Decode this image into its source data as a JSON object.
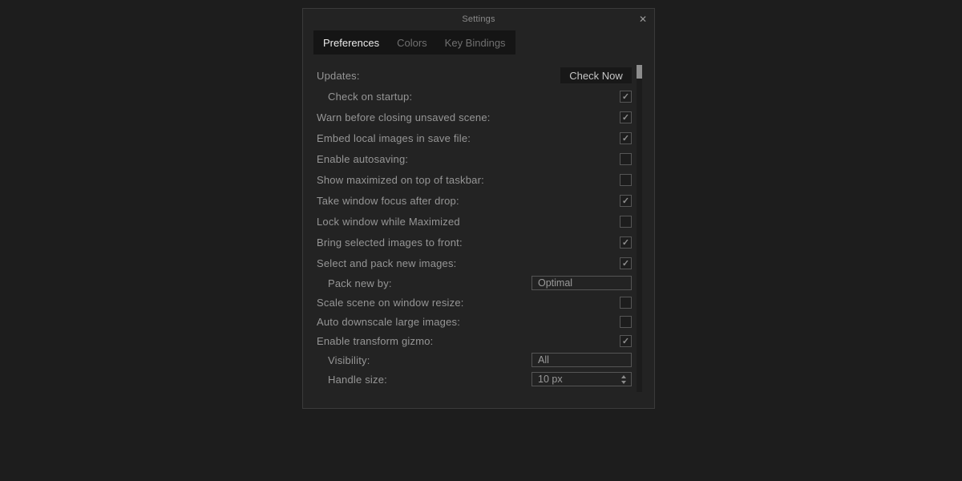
{
  "window": {
    "title": "Settings"
  },
  "icons": {
    "close": "✕",
    "check": "✓"
  },
  "colors": {
    "page_bg": "#1d1d1d",
    "dialog_bg": "#232323",
    "dialog_border": "#3a3a3a",
    "tabstrip_bg": "#151515",
    "active_tab_text": "#ebebeb",
    "inactive_tab_text": "#707070",
    "label_text": "#969696",
    "control_border": "#555555",
    "scroll_thumb": "#8d8d8d"
  },
  "tabs": [
    {
      "label": "Preferences",
      "active": true
    },
    {
      "label": "Colors",
      "active": false
    },
    {
      "label": "Key Bindings",
      "active": false
    }
  ],
  "preferences": {
    "rows": [
      {
        "name": "updates",
        "label": "Updates:",
        "indent": false,
        "control": "button",
        "value": "Check Now"
      },
      {
        "name": "check-on-startup",
        "label": "Check on startup:",
        "indent": true,
        "control": "checkbox",
        "checked": true
      },
      {
        "name": "warn-before-closing-unsaved-scene",
        "label": "Warn before closing unsaved scene:",
        "indent": false,
        "control": "checkbox",
        "checked": true
      },
      {
        "name": "embed-local-images-in-save-file",
        "label": "Embed local images in save file:",
        "indent": false,
        "control": "checkbox",
        "checked": true
      },
      {
        "name": "enable-autosaving",
        "label": "Enable autosaving:",
        "indent": false,
        "control": "checkbox",
        "checked": false
      },
      {
        "name": "show-maximized-on-top-of-taskbar",
        "label": "Show maximized on top of taskbar:",
        "indent": false,
        "control": "checkbox",
        "checked": false
      },
      {
        "name": "take-window-focus-after-drop",
        "label": "Take window focus after drop:",
        "indent": false,
        "control": "checkbox",
        "checked": true
      },
      {
        "name": "lock-window-while-maximized",
        "label": "Lock window while Maximized",
        "indent": false,
        "control": "checkbox",
        "checked": false
      },
      {
        "name": "bring-selected-images-to-front",
        "label": "Bring selected images to front:",
        "indent": false,
        "control": "checkbox",
        "checked": true
      },
      {
        "name": "select-and-pack-new-images",
        "label": "Select and pack new images:",
        "indent": false,
        "control": "checkbox",
        "checked": true
      },
      {
        "name": "pack-new-by",
        "label": "Pack new by:",
        "indent": true,
        "control": "combo",
        "value": "Optimal"
      },
      {
        "name": "scale-scene-on-window-resize",
        "label": "Scale scene on window resize:",
        "indent": false,
        "control": "checkbox",
        "checked": false
      },
      {
        "name": "auto-downscale-large-images",
        "label": "Auto downscale large images:",
        "indent": false,
        "control": "checkbox",
        "checked": false
      },
      {
        "name": "enable-transform-gizmo",
        "label": "Enable transform gizmo:",
        "indent": false,
        "control": "checkbox",
        "checked": true
      },
      {
        "name": "visibility",
        "label": "Visibility:",
        "indent": true,
        "control": "combo",
        "value": "All"
      },
      {
        "name": "handle-size",
        "label": "Handle size:",
        "indent": true,
        "control": "spinner",
        "value": "10 px"
      }
    ]
  }
}
